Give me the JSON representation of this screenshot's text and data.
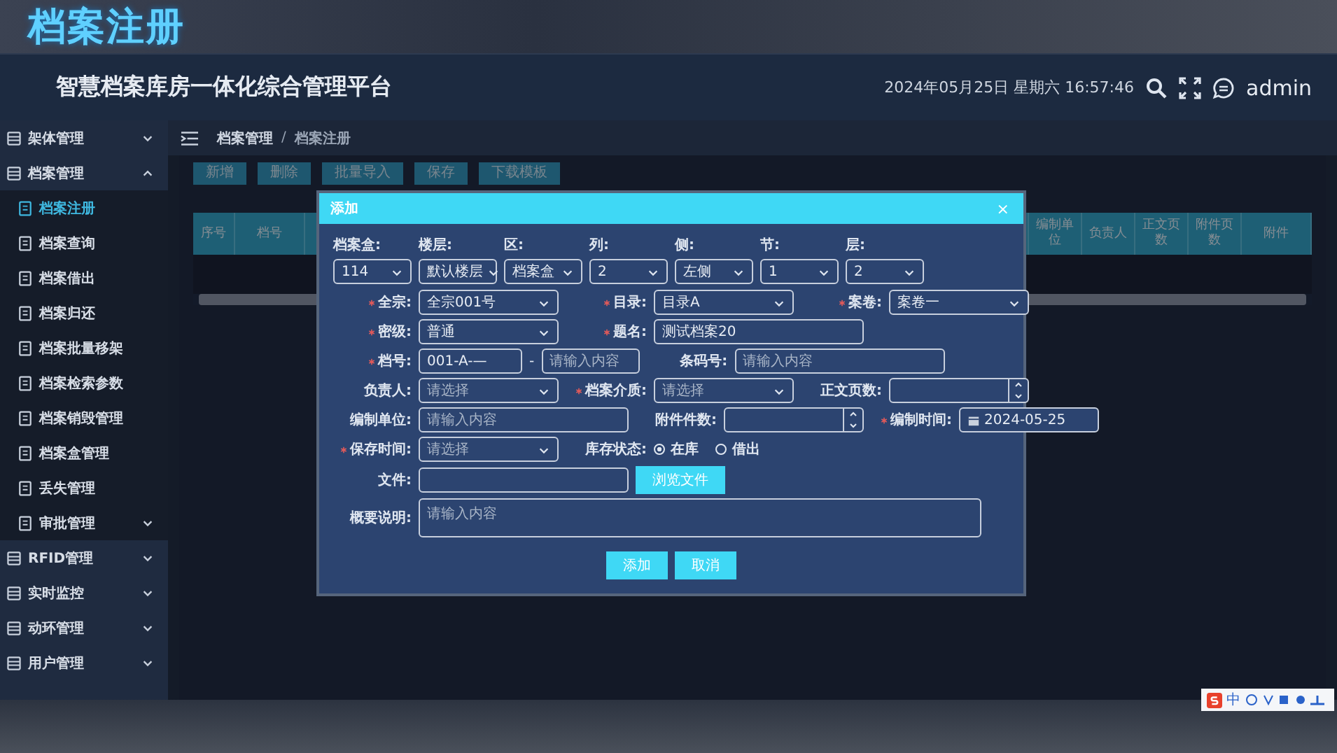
{
  "banner": {
    "title": "档案注册"
  },
  "header": {
    "title": "智慧档案库房一体化综合管理平台",
    "datetime": "2024年05月25日 星期六 16:57:46",
    "user": "admin"
  },
  "sidebar": {
    "items": [
      {
        "label": "架体管理",
        "expanded": false
      },
      {
        "label": "档案管理",
        "expanded": true,
        "children": [
          {
            "label": "档案注册",
            "selected": true
          },
          {
            "label": "档案查询",
            "selected": false
          },
          {
            "label": "档案借出",
            "selected": false
          },
          {
            "label": "档案归还",
            "selected": false
          },
          {
            "label": "档案批量移架",
            "selected": false
          },
          {
            "label": "档案检索参数",
            "selected": false
          },
          {
            "label": "档案销毁管理",
            "selected": false
          },
          {
            "label": "档案盒管理",
            "selected": false
          },
          {
            "label": "丢失管理",
            "selected": false
          },
          {
            "label": "审批管理",
            "selected": false,
            "expandable": true
          }
        ]
      },
      {
        "label": "RFID管理",
        "expanded": false
      },
      {
        "label": "实时监控",
        "expanded": false
      },
      {
        "label": "动环管理",
        "expanded": false
      },
      {
        "label": "用户管理",
        "expanded": false
      }
    ]
  },
  "breadcrumb": {
    "items": [
      "档案管理",
      "档案注册"
    ],
    "separator": "/"
  },
  "toolbar": [
    "新增",
    "删除",
    "批量导入",
    "保存",
    "下载模板"
  ],
  "table": {
    "columns_left": [
      "序号",
      "档号"
    ],
    "columns_right": [
      "编制单位",
      "负责人",
      "正文页数",
      "附件页数",
      "附件"
    ]
  },
  "dialog": {
    "title": "添加",
    "close": "×",
    "location": [
      {
        "label": "档案盒:",
        "value": "114"
      },
      {
        "label": "楼层:",
        "value": "默认楼层"
      },
      {
        "label": "区:",
        "value": "档案盒"
      },
      {
        "label": "列:",
        "value": "2"
      },
      {
        "label": "侧:",
        "value": "左侧"
      },
      {
        "label": "节:",
        "value": "1"
      },
      {
        "label": "层:",
        "value": "2"
      }
    ],
    "rows": [
      [
        {
          "kind": "select",
          "label": "全宗:",
          "required": true,
          "value": "全宗001号"
        },
        {
          "kind": "select",
          "label": "目录:",
          "required": true,
          "value": "目录A"
        },
        {
          "kind": "select",
          "label": "案卷:",
          "required": true,
          "value": "案卷一"
        }
      ],
      [
        {
          "kind": "select",
          "label": "密级:",
          "required": true,
          "value": "普通"
        },
        {
          "kind": "text",
          "label": "题名:",
          "required": true,
          "value": "测试档案20"
        }
      ],
      [
        {
          "kind": "split",
          "label": "档号:",
          "required": true,
          "value": "001-A-—",
          "separator": "-",
          "placeholder": "请输入内容"
        },
        {
          "kind": "text",
          "label": "条码号:",
          "required": false,
          "placeholder": "请输入内容"
        }
      ],
      [
        {
          "kind": "select",
          "label": "负责人:",
          "required": false,
          "placeholder": "请选择"
        },
        {
          "kind": "select",
          "label": "档案介质:",
          "required": true,
          "placeholder": "请选择"
        },
        {
          "kind": "number",
          "label": "正文页数:",
          "required": false
        }
      ],
      [
        {
          "kind": "text",
          "label": "编制单位:",
          "required": false,
          "placeholder": "请输入内容"
        },
        {
          "kind": "number",
          "label": "附件件数:",
          "required": false
        },
        {
          "kind": "date",
          "label": "编制时间:",
          "required": true,
          "value": "2024-05-25"
        }
      ],
      [
        {
          "kind": "select",
          "label": "保存时间:",
          "required": true,
          "placeholder": "请选择"
        },
        {
          "kind": "radio",
          "label": "库存状态:",
          "required": false,
          "options": [
            {
              "label": "在库",
              "selected": true
            },
            {
              "label": "借出",
              "selected": false
            }
          ]
        }
      ],
      [
        {
          "kind": "file",
          "label": "文件:",
          "required": false,
          "button": "浏览文件"
        }
      ],
      [
        {
          "kind": "textarea",
          "label": "概要说明:",
          "required": false,
          "placeholder": "请输入内容"
        }
      ]
    ],
    "buttons": [
      "添加",
      "取消"
    ]
  },
  "ime": {
    "label": "中"
  }
}
